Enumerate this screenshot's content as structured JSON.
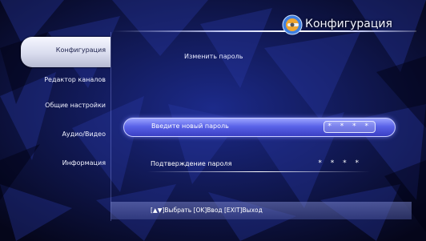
{
  "header": {
    "title": "Конфигурация",
    "icon": "wrench-gear-icon"
  },
  "sidebar": {
    "items": [
      {
        "label": "Конфигурация",
        "active": true
      },
      {
        "label": "Редактор каналов",
        "active": false
      },
      {
        "label": "Общие настройки",
        "active": false
      },
      {
        "label": "Аудио/Видео",
        "active": false
      },
      {
        "label": "Информация",
        "active": false
      }
    ]
  },
  "main": {
    "section_title": "Изменить пароль",
    "fields": [
      {
        "label": "Введите новый пароль",
        "value": "* * * *",
        "selected": true
      },
      {
        "label": "Подтверждение пароля",
        "value": "* * * *",
        "selected": false
      }
    ]
  },
  "footer": {
    "hint": "[▲▼]Выбрать  [OK]Ввод     [EXIT]Выход"
  },
  "colors": {
    "background": "#0a0d2e",
    "accent": "#5a63e8",
    "highlight": "#f6f7ff"
  }
}
